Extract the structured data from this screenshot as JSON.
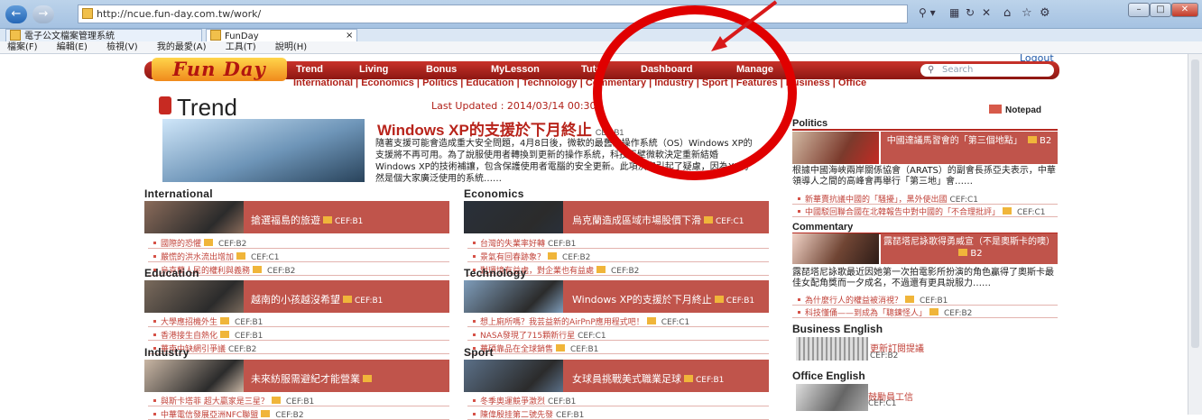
{
  "browser": {
    "url": "http://ncue.fun-day.com.tw/work/",
    "tab1": "電子公文檔案管理系統",
    "tab2": "FunDay",
    "menu": [
      "檔案(F)",
      "編輯(E)",
      "檢視(V)",
      "我的最愛(A)",
      "工具(T)",
      "說明(H)"
    ],
    "close_tab": "×"
  },
  "site": {
    "logo": "Fun Day",
    "logout": "Logout",
    "nav": [
      "Trend",
      "Living",
      "Bonus",
      "MyLesson",
      "Tutor",
      "Dashboard",
      "Manage"
    ],
    "search_placeholder": "Search",
    "subnav": "International | Economics | Politics | Education | Technology | Commentary | Industry | Sport | Features | Business | Office"
  },
  "page": {
    "title": "Trend",
    "updated": "Last Updated : 2014/03/14 00:30",
    "notepad": "Notepad"
  },
  "headline": {
    "title": "Windows XP的支援於下月終止",
    "cef": "CEF:B1",
    "body": "隨著支援可能會造成重大安全問題，4月8日後，微軟的最舊的操作系統（OS）Windows XP的支援將不再可用。為了說服使用者轉換到更新的操作系統，科技巨擘微軟決定重新結婚Windows XP的技術補讓，包含保護使用者電腦的安全更新。此項決定引起了疑慮，因為XP仍然是個大家廣泛使用的系統……"
  },
  "sections": [
    {
      "name": "International",
      "card": "搶選福島的旅遊",
      "cef": "CEF:B1",
      "items": [
        {
          "t": "國際的恐懼",
          "c": "CEF:B2",
          "b": true
        },
        {
          "t": "嚴慌的洪水流出增加",
          "c": "CEF:C1",
          "b": true
        },
        {
          "t": "烏克蘭人民的權利與義務",
          "c": "CEF:B2",
          "b": true
        }
      ]
    },
    {
      "name": "Economics",
      "card": "烏克蘭造成區域市場股價下滑",
      "cef": "CEF:C1",
      "items": [
        {
          "t": "台灣的失業率好轉",
          "c": "CEF:B1",
          "b": false
        },
        {
          "t": "景氣有回春跡象？",
          "c": "CEF:B2",
          "b": true
        },
        {
          "t": "對環境有益處，對企業也有益處",
          "c": "CEF:B2",
          "b": true
        }
      ]
    },
    {
      "name": "Education",
      "card": "越南的小孩越沒希望",
      "cef": "CEF:B1",
      "items": [
        {
          "t": "大學應招機外生",
          "c": "CEF:B1",
          "b": true
        },
        {
          "t": "香港接生自熱化",
          "c": "CEF:B1",
          "b": true
        },
        {
          "t": "華南中缺網引爭議",
          "c": "CEF:B2",
          "b": false
        }
      ]
    },
    {
      "name": "Technology",
      "card": "Windows XP的支援於下月終止",
      "cef": "CEF:B1",
      "items": [
        {
          "t": "想上廁所嗎？我芸益新的AirPnP應用程式吧！",
          "c": "CEF:C1",
          "b": true
        },
        {
          "t": "NASA發現了715顆新行星",
          "c": "CEF:C1",
          "b": false
        },
        {
          "t": "華碩靠品在全球銷售",
          "c": "CEF:B1",
          "b": true
        }
      ]
    },
    {
      "name": "Industry",
      "card": "未來紡服需避紀才能營業",
      "cef": "",
      "items": [
        {
          "t": "與斯卡塔菲 超大贏家是三星？",
          "c": "CEF:B1",
          "b": true
        },
        {
          "t": "中華電信發展亞洲NFC聯盟",
          "c": "CEF:B2",
          "b": true
        }
      ]
    },
    {
      "name": "Sport",
      "card": "女球員挑戰美式職業足球",
      "cef": "CEF:B1",
      "items": [
        {
          "t": "冬季奧運競爭激烈",
          "c": "CEF:B1",
          "b": false
        },
        {
          "t": "陳偉殷挂第二號先發",
          "c": "CEF:B1",
          "b": false
        }
      ]
    }
  ],
  "right": {
    "politics": {
      "head": "Politics",
      "box": "中國達議馬習會的「第三個地點」",
      "cef": "B2",
      "body": "根據中國海峽兩岸關係協會（ARATS）的副會長孫亞夫表示，中華領導人之間的高峰會再舉行「第三地」會……",
      "items": [
        {
          "t": "新華賣抗議中國的「騷擾」，黑外使出國",
          "c": "CEF:C1",
          "b": false
        },
        {
          "t": "中國駁回聯合國在北韓報告中對中國的「不合理批評」",
          "c": "CEF:C1",
          "b": true
        }
      ]
    },
    "commentary": {
      "head": "Commentary",
      "box": "露琵塔尼詠歌得勇威宣（不是奧斯卡的噢）",
      "cef": "B2",
      "body": "露琵塔尼詠歌最近因她第一次拍電影所扮演的角色贏得了奧斯卡最佳女配角獎而一夕成名，不過還有更具說服力……",
      "items": [
        {
          "t": "為什麼行人的權益被消視？",
          "c": "CEF:B1",
          "b": true
        },
        {
          "t": "科技懂俑——到成為「聰鍊怪人」",
          "c": "CEF:B2",
          "b": true
        }
      ]
    },
    "business": {
      "head": "Business English",
      "text": "更新訂閱提議",
      "cef": "CEF:B2"
    },
    "office": {
      "head": "Office English",
      "text": "鼓勵員工信",
      "cef": "CEF:C1"
    }
  }
}
